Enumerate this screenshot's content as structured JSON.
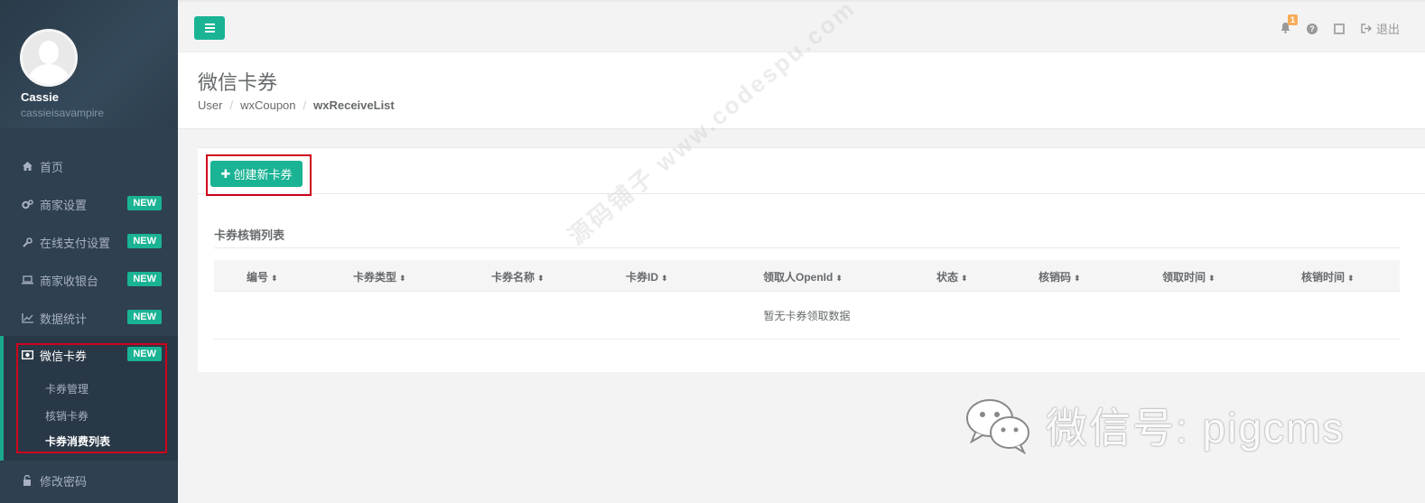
{
  "profile": {
    "name": "Cassie",
    "username": "cassieisavampire"
  },
  "nav": {
    "items": [
      {
        "label": "首页",
        "icon": "home-icon",
        "badge": ""
      },
      {
        "label": "商家设置",
        "icon": "cogs-icon",
        "badge": "NEW"
      },
      {
        "label": "在线支付设置",
        "icon": "wrench-icon",
        "badge": "NEW"
      },
      {
        "label": "商家收银台",
        "icon": "laptop-icon",
        "badge": "NEW"
      },
      {
        "label": "数据统计",
        "icon": "line-chart-icon",
        "badge": "NEW"
      },
      {
        "label": "微信卡券",
        "icon": "money-icon",
        "badge": "NEW"
      }
    ],
    "submenu": [
      "卡券管理",
      "核销卡券",
      "卡券消费列表"
    ],
    "bottom": {
      "label": "修改密码",
      "icon": "lock-icon"
    }
  },
  "topbar": {
    "notification_count": "1",
    "logout_label": "退出"
  },
  "header": {
    "title": "微信卡券",
    "breadcrumb": [
      "User",
      "wxCoupon",
      "wxReceiveList"
    ]
  },
  "content": {
    "create_button": "创建新卡券",
    "section_title": "卡券核销列表",
    "columns": [
      "编号",
      "卡券类型",
      "卡券名称",
      "卡券ID",
      "领取人OpenId",
      "状态",
      "核销码",
      "领取时间",
      "核销时间"
    ],
    "empty_text": "暂无卡券领取数据"
  },
  "watermarks": {
    "diagonal": "源码铺子 www.codespu.com",
    "brand": "微信号: pigcms"
  },
  "colors": {
    "sidebar_bg": "#2f4050",
    "accent": "#1ab394",
    "highlight_box": "#d0021b"
  }
}
